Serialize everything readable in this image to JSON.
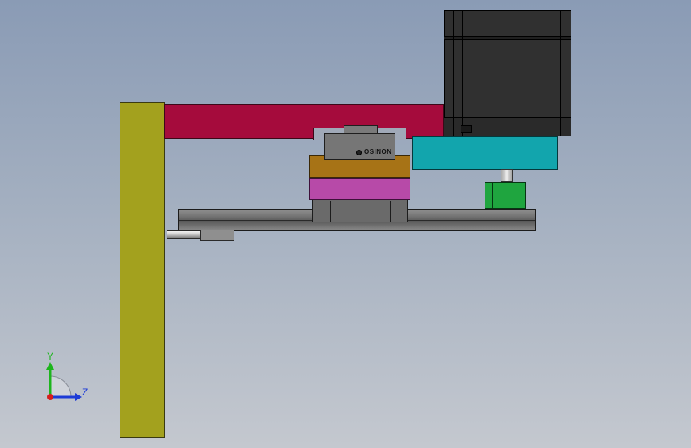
{
  "scene": {
    "carriage_brand_text": "OSINON",
    "colors": {
      "upright_plate": "#a3a11e",
      "arm": "#a50b3c",
      "orange_block": "#a77316",
      "purple_block": "#b74aa8",
      "motor_mount": "#12a5ad",
      "coupler": "#1fa53f",
      "motor": "#303030",
      "rail": "#767676"
    }
  },
  "triad": {
    "y_label": "Y",
    "z_label": "Z",
    "colors": {
      "y_axis": "#1db51d",
      "z_axis": "#1d3bd6",
      "x_origin": "#d61d1d"
    }
  }
}
